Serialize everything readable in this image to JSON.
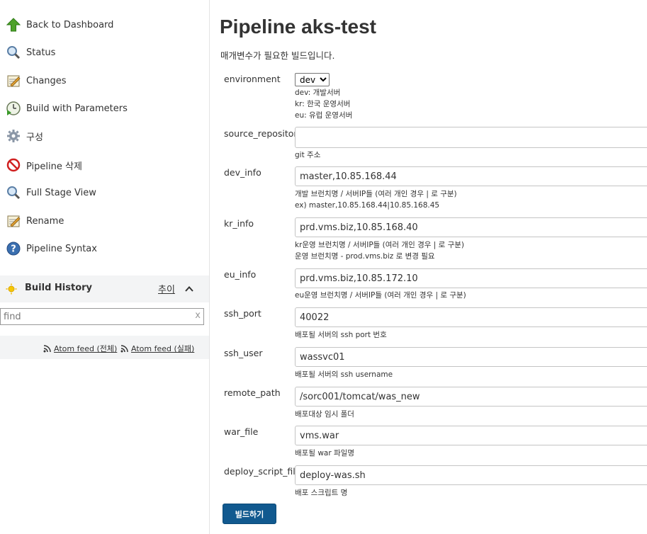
{
  "sidebar": {
    "tasks": [
      {
        "label": "Back to Dashboard",
        "icon": "up-arrow-icon"
      },
      {
        "label": "Status",
        "icon": "magnifier-icon"
      },
      {
        "label": "Changes",
        "icon": "notepad-icon"
      },
      {
        "label": "Build with Parameters",
        "icon": "clock-play-icon"
      },
      {
        "label": "구성",
        "icon": "gear-icon"
      },
      {
        "label": "Pipeline 삭제",
        "icon": "no-entry-icon"
      },
      {
        "label": "Full Stage View",
        "icon": "magnifier-icon"
      },
      {
        "label": "Rename",
        "icon": "notepad-icon"
      },
      {
        "label": "Pipeline Syntax",
        "icon": "help-icon"
      }
    ],
    "build_history": {
      "title": "Build History",
      "trend_label": "추이",
      "find_placeholder": "find",
      "clear_label": "x",
      "feed_all": "Atom feed (전체)",
      "feed_failed": "Atom feed (실패)"
    }
  },
  "main": {
    "title": "Pipeline aks-test",
    "subtitle": "매개변수가 필요한 빌드입니다.",
    "environment": {
      "label": "environment",
      "selected": "dev",
      "desc": [
        "dev: 개발서버",
        "kr: 한국 운영서버",
        "eu: 유럽 운영서버"
      ]
    },
    "params": [
      {
        "label": "source_repository",
        "value": "",
        "desc": [
          "git 주소"
        ]
      },
      {
        "label": "dev_info",
        "value": "master,10.85.168.44",
        "desc": [
          "개발 브런치명 / 서버IP들 (여러 개인 경우 | 로 구분)",
          "ex) master,10.85.168.44|10.85.168.45"
        ]
      },
      {
        "label": "kr_info",
        "value": "prd.vms.biz,10.85.168.40",
        "desc": [
          "kr운영 브런치명 / 서버IP들 (여러 개인 경우 | 로 구분)",
          "운영 브런치명 - prod.vms.biz 로 변경 필요"
        ]
      },
      {
        "label": "eu_info",
        "value": "prd.vms.biz,10.85.172.10",
        "desc": [
          "eu운영 브런치명 / 서버IP들 (여러 개인 경우 | 로 구분)"
        ]
      },
      {
        "label": "ssh_port",
        "value": "40022",
        "desc": [
          "배포될 서버의 ssh port 번호"
        ]
      },
      {
        "label": "ssh_user",
        "value": "wassvc01",
        "desc": [
          "배포될 서버의 ssh username"
        ]
      },
      {
        "label": "remote_path",
        "value": "/sorc001/tomcat/was_new",
        "desc": [
          "배포대상 임시 폴더"
        ]
      },
      {
        "label": "war_file",
        "value": "vms.war",
        "desc": [
          "배포될 war 파일명"
        ]
      },
      {
        "label": "deploy_script_file",
        "value": "deploy-was.sh",
        "desc": [
          "배포 스크립트 명"
        ]
      }
    ],
    "build_button": "빌드하기"
  }
}
